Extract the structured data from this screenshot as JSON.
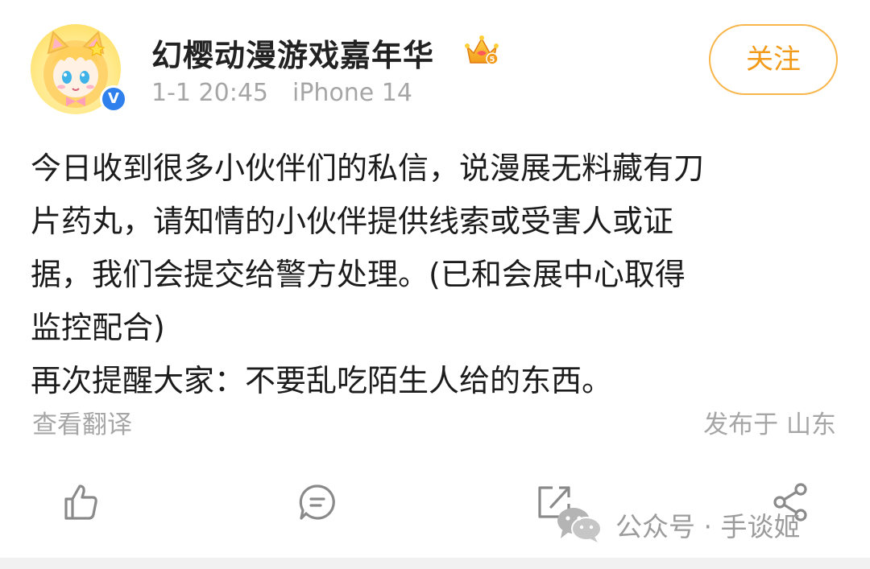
{
  "user": {
    "name": "幻樱动漫游戏嘉年华",
    "crown_level": "5"
  },
  "post": {
    "time": "1-1 20:45",
    "device": "iPhone 14",
    "lines": [
      "今日收到很多小伙伴们的私信，说漫展无料藏有刀",
      "片药丸，请知情的小伙伴提供线索或受害人或证",
      "据，我们会提交给警方处理。(已和会展中心取得",
      "监控配合)",
      "再次提醒大家：不要乱吃陌生人给的东西。"
    ],
    "translate_label": "查看翻译",
    "location": "发布于 山东"
  },
  "header": {
    "follow_label": "关注"
  },
  "actions": [
    {
      "name": "like",
      "icon": "thumbs-up-icon"
    },
    {
      "name": "comment",
      "icon": "comment-icon"
    },
    {
      "name": "repost",
      "icon": "repost-icon"
    },
    {
      "name": "share",
      "icon": "share-icon"
    }
  ],
  "watermark": {
    "text": "公众号 · 手谈姬"
  },
  "colors": {
    "accent": "#f29b1b",
    "text": "#1c1c1c",
    "muted": "#a6a6a6",
    "verified": "#2f80ed"
  }
}
